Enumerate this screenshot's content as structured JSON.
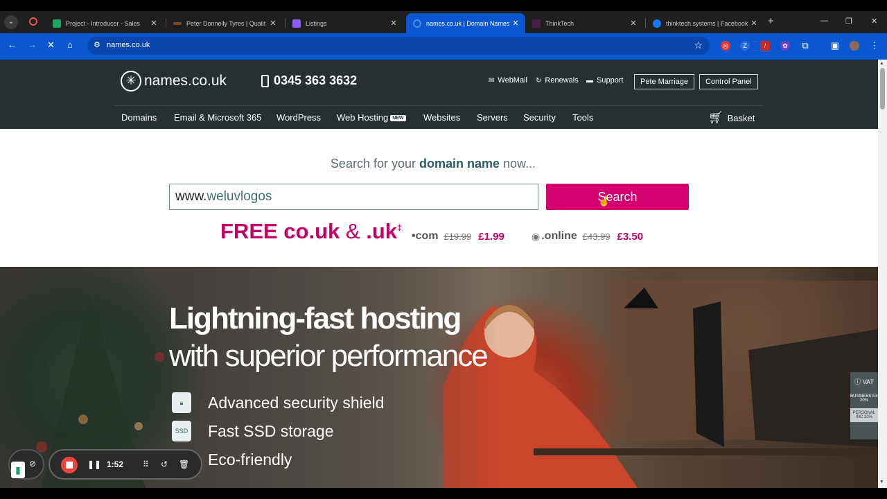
{
  "browser": {
    "tabs": [
      {
        "title": "Project - Introducer - Sales",
        "fav": "#1fa463"
      },
      {
        "title": "Peter Donnelly Tyres | Qualit",
        "fav": "#7a4b2a"
      },
      {
        "title": "Listings",
        "fav": "#8b5cf6"
      },
      {
        "title": "names.co.uk | Domain Names",
        "fav": "#0b57d0"
      },
      {
        "title": "ThinkTech",
        "fav": "#4a1d4a"
      },
      {
        "title": "thinktech.systems | Facebook",
        "fav": "#1877f2"
      }
    ],
    "url": "names.co.uk"
  },
  "site": {
    "logo": "names.co.uk",
    "phone": "0345 363 3632",
    "links": {
      "webmail": "WebMail",
      "renewals": "Renewals",
      "support": "Support"
    },
    "buttons": {
      "account": "Pete Marriage",
      "control_panel": "Control Panel"
    },
    "nav": [
      "Domains",
      "Email & Microsoft 365",
      "WordPress",
      "Web Hosting",
      "Websites",
      "Servers",
      "Security",
      "Tools"
    ],
    "new_badge": "NEW",
    "basket": "Basket"
  },
  "search": {
    "title_pre": "Search for your",
    "title_bold": "domain name",
    "title_post": "now...",
    "prefix": "www.",
    "value": "weluvlogos",
    "button": "Search"
  },
  "promo": {
    "free_a": "FREE co.uk",
    "amp": "&",
    "free_b": ".uk",
    "mark": "‡",
    "com": {
      "name": "•com",
      "old": "£19.99",
      "new": "£1.99"
    },
    "online": {
      "name": ".online",
      "old": "£43.99",
      "new": "£3.50"
    }
  },
  "hero": {
    "h1": "Lightning-fast hosting",
    "h2": "with superior performance",
    "features": [
      "Advanced security shield",
      "Fast SSD storage",
      "Eco-friendly"
    ]
  },
  "vat": {
    "label": "VAT",
    "business": "BUSINESS EX 20%",
    "personal": "PERSONAL INC 20%"
  },
  "recorder": {
    "time": "1:52"
  }
}
